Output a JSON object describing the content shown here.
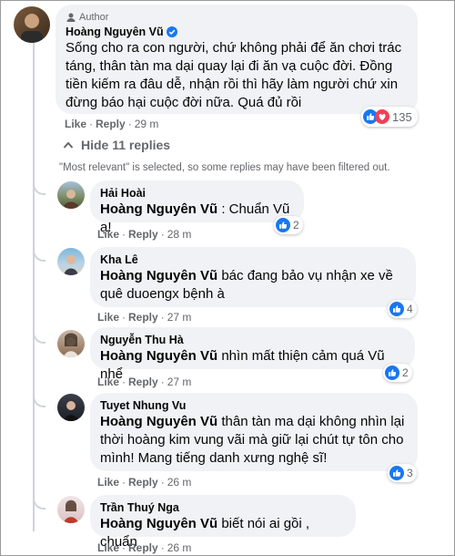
{
  "main": {
    "author_badge": "Author",
    "name": "Hoàng Nguyên Vũ",
    "text": "Sống cho ra con người, chứ không phải để ăn chơi trác táng, thân tàn ma dại quay lại đi ăn vạ cuộc đời. Đồng tiền kiếm ra đâu dễ, nhận rồi thì hãy làm người chứ xin đừng báo hại cuộc đời nữa. Quá đủ rồi",
    "like_label": "Like",
    "reply_label": "Reply",
    "time": "29 m",
    "reaction_count": "135"
  },
  "hide_replies_label": "Hide 11 replies",
  "filter_notice": "\"Most relevant\" is selected, so some replies may have been filtered out.",
  "replies": [
    {
      "name": "Hải Hoài",
      "mention": "Hoàng Nguyên Vũ",
      "text": " : Chuẩn Vũ ạ!",
      "like_label": "Like",
      "reply_label": "Reply",
      "time": "28 m",
      "reaction_count": "2"
    },
    {
      "name": "Kha Lê",
      "mention": "Hoàng Nguyên Vũ",
      "text": " bác đang bảo vụ nhận xe về quê duoengx bệnh à",
      "like_label": "Like",
      "reply_label": "Reply",
      "time": "27 m",
      "reaction_count": "4"
    },
    {
      "name": "Nguyễn Thu Hà",
      "mention": "Hoàng Nguyên Vũ",
      "text": " nhìn mất thiện cảm quá Vũ nhể",
      "like_label": "Like",
      "reply_label": "Reply",
      "time": "27 m",
      "reaction_count": "2"
    },
    {
      "name": "Tuyet Nhung Vu",
      "mention": "Hoàng Nguyên Vũ",
      "text": " thân tàn ma dại không nhìn lại thời hoàng kim vung vãi mà giữ lại chút tự tôn cho mình! Mang tiếng danh xưng nghệ sĩ!",
      "like_label": "Like",
      "reply_label": "Reply",
      "time": "26 m",
      "reaction_count": "3"
    },
    {
      "name": "Trần Thuý Nga",
      "mention": "Hoàng Nguyên Vũ",
      "text": " biết nói ai gồi , chuẩn",
      "like_label": "Like",
      "reply_label": "Reply",
      "time": "26 m"
    }
  ],
  "colors": {
    "like_blue": "#1877f2",
    "love_red": "#f33e58",
    "bubble": "#f0f2f5",
    "meta": "#65676b"
  }
}
